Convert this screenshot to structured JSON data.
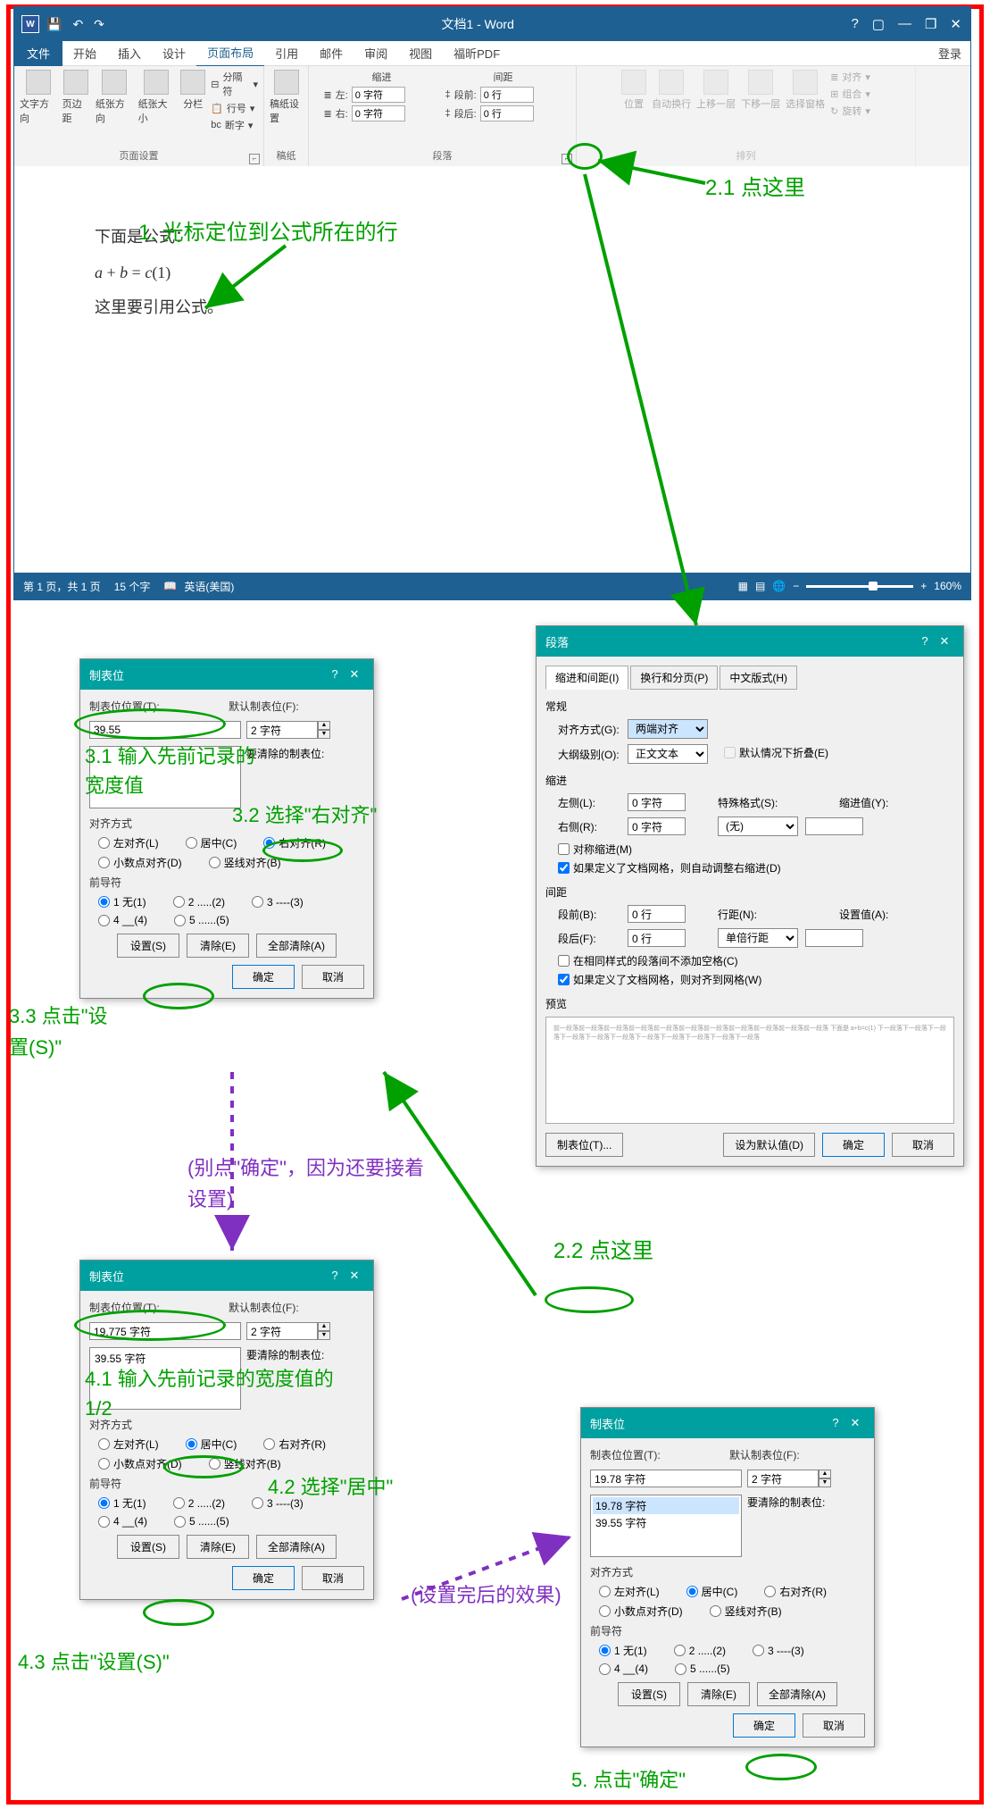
{
  "word": {
    "title": "文档1 - Word",
    "signin": "登录",
    "menu": {
      "file": "文件",
      "home": "开始",
      "insert": "插入",
      "design": "设计",
      "layout": "页面布局",
      "references": "引用",
      "mail": "邮件",
      "review": "审阅",
      "view": "视图",
      "foxin": "福昕PDF"
    },
    "ribbon": {
      "page_setup": "页面设置",
      "text_dir": "文字方向",
      "margins": "页边距",
      "orient": "纸张方向",
      "size": "纸张大小",
      "columns": "分栏",
      "breaks": "分隔符",
      "line_num": "行号",
      "hyphen": "断字",
      "paper": "稿纸",
      "paper_set": "稿纸设置",
      "paragraph": "段落",
      "indent": "缩进",
      "left": "左:",
      "right": "右:",
      "indent_val": "0 字符",
      "spacing": "间距",
      "before": "段前:",
      "after": "段后:",
      "space_val": "0 行",
      "arrange": "排列",
      "position": "位置",
      "wrap": "自动换行",
      "forward": "上移一层",
      "backward": "下移一层",
      "selection": "选择窗格",
      "align": "对齐",
      "group": "组合",
      "rotate": "旋转"
    },
    "doc": {
      "line1": "下面是公式：",
      "line2": "a + b = c(1)",
      "line3": "这里要引用公式。"
    },
    "status": {
      "page": "第 1 页，共 1 页",
      "words": "15 个字",
      "lang": "英语(美国)",
      "zoom": "160%"
    }
  },
  "annotations": {
    "a1": "1. 光标定位到公式所在的行",
    "a21": "2.1 点这里",
    "a22": "2.2 点这里",
    "a31": "3.1 输入先前记录的宽度值",
    "a32": "3.2 选择\"右对齐\"",
    "a33": "3.3 点击\"设置(S)\"",
    "warn1": "(别点\"确定\"，因为还要接着设置)",
    "a41": "4.1 输入先前记录的宽度值的1/2",
    "a42": "4.2 选择\"居中\"",
    "a43": "4.3 点击\"设置(S)\"",
    "warn2": "(设置完后的效果)",
    "a5": "5. 点击\"确定\""
  },
  "para_dlg": {
    "title": "段落",
    "tab1": "缩进和间距(I)",
    "tab2": "换行和分页(P)",
    "tab3": "中文版式(H)",
    "general": "常规",
    "align_label": "对齐方式(G):",
    "align_val": "两端对齐",
    "outline_label": "大纲级别(O):",
    "outline_val": "正文文本",
    "collapse": "默认情况下折叠(E)",
    "indent": "缩进",
    "left_label": "左侧(L):",
    "right_label": "右侧(R):",
    "indent_val": "0 字符",
    "special_label": "特殊格式(S):",
    "special_val": "(无)",
    "indent_by": "缩进值(Y):",
    "mirror": "对称缩进(M)",
    "auto_indent": "如果定义了文档网格，则自动调整右缩进(D)",
    "spacing": "间距",
    "before_label": "段前(B):",
    "after_label": "段后(F):",
    "space_val": "0 行",
    "line_spacing_label": "行距(N):",
    "line_spacing_val": "单倍行距",
    "set_val": "设置值(A):",
    "no_space": "在相同样式的段落间不添加空格(C)",
    "snap_grid": "如果定义了文档网格，则对齐到网格(W)",
    "preview": "预览",
    "preview_text": "前一段落前一段落前一段落前一段落前一段落前一段落前一段落前一段落前一段落前一段落前一段落\n下面是\na+b=c(1)\n下一段落下一段落下一段落下一段落下一段落下一段落下一段落下一段落下一段落下一段落下一段落",
    "tabs_btn": "制表位(T)...",
    "default_btn": "设为默认值(D)",
    "ok": "确定",
    "cancel": "取消"
  },
  "tabs_dlg": {
    "title": "制表位",
    "pos_label": "制表位位置(T):",
    "default_label": "默认制表位(F):",
    "default_val": "2 字符",
    "clear_label": "要清除的制表位:",
    "align": "对齐方式",
    "left": "左对齐(L)",
    "center": "居中(C)",
    "right": "右对齐(R)",
    "decimal": "小数点对齐(D)",
    "bar": "竖线对齐(B)",
    "leader": "前导符",
    "l1": "1 无(1)",
    "l2": "2 .....(2)",
    "l3": "3 ----(3)",
    "l4": "4 __(4)",
    "l5": "5 ......(5)",
    "set": "设置(S)",
    "clear": "清除(E)",
    "clear_all": "全部清除(A)",
    "ok": "确定",
    "cancel": "取消",
    "val1": "39.55",
    "val2": "19.775 字符",
    "val2b": "39.55 字符",
    "list1": "19.78 字符",
    "list2": "19.78 字符",
    "list3": "39.55 字符"
  }
}
